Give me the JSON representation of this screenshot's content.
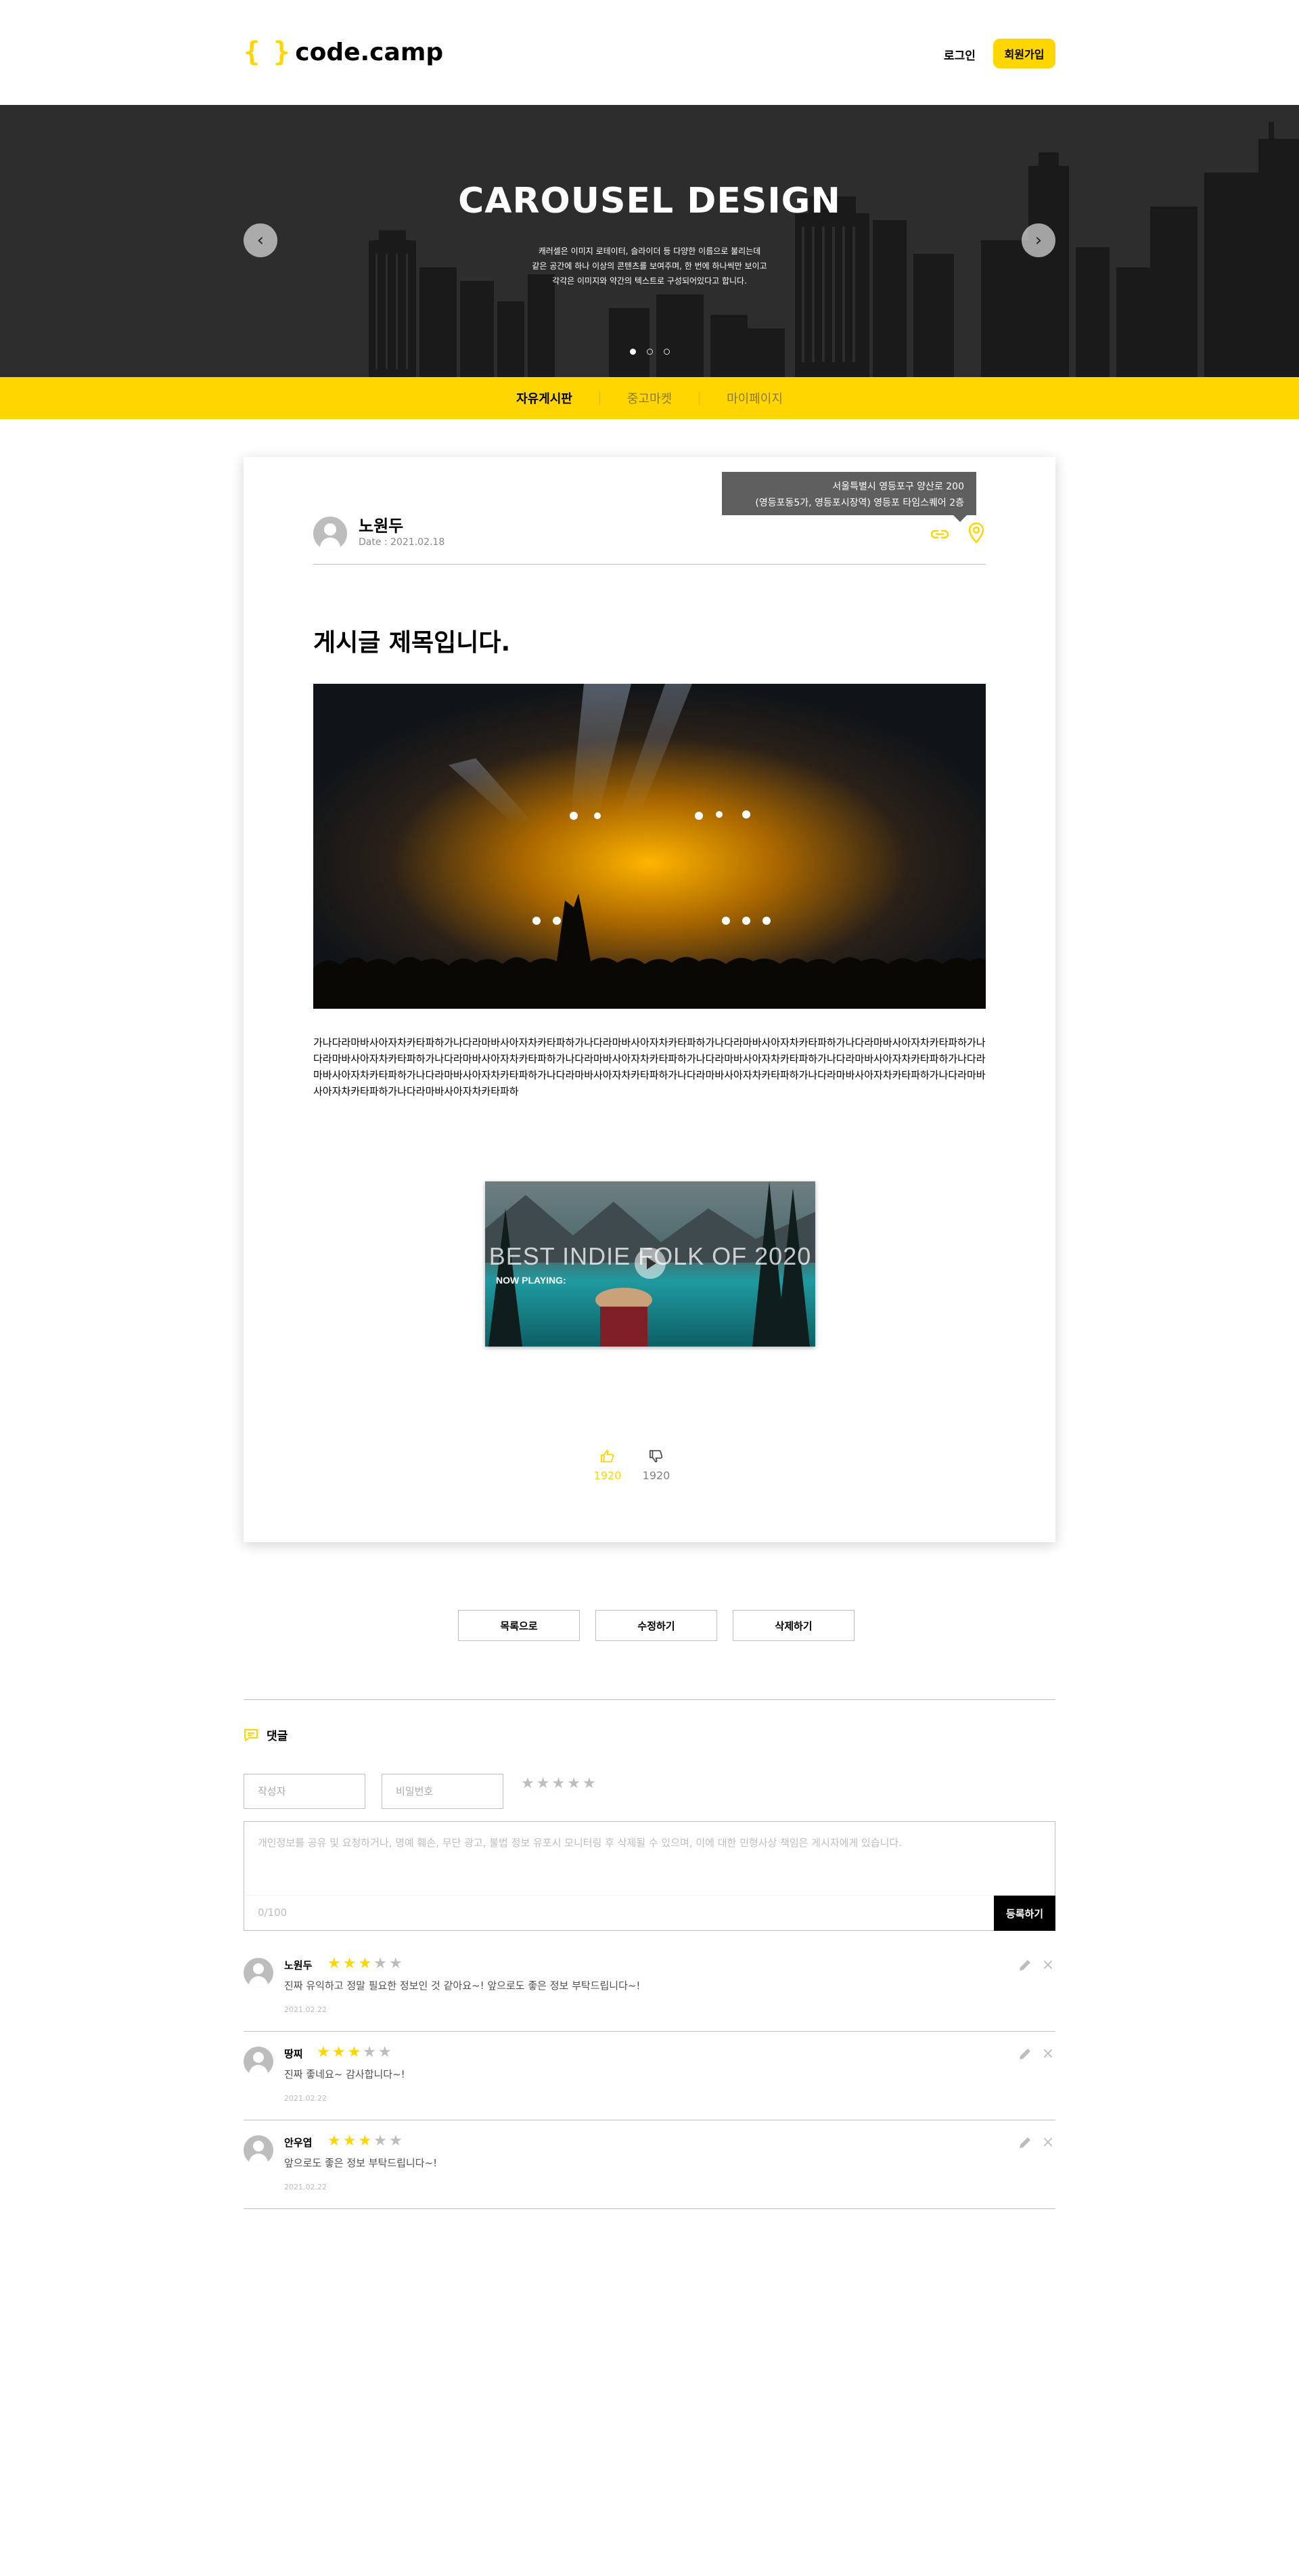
{
  "header": {
    "logo_braces": "{ }",
    "logo_text": "code.camp",
    "login": "로그인",
    "signup": "회원가입"
  },
  "banner": {
    "title": "CAROUSEL DESIGN",
    "desc_line1": "캐러셀은 이미지 로테이터, 슬라이더 등 다양한 이름으로 불리는데",
    "desc_line2": "같은 공간에 하나 이상의 콘텐츠를 보여주며, 한 번에 하나씩만 보이고",
    "desc_line3": "각각은 이미지와 약간의 텍스트로 구성되어있다고 합니다.",
    "prev": "‹",
    "next": "›",
    "dots_count": 3,
    "active_dot": 1
  },
  "nav": {
    "items": [
      "자유게시판",
      "중고마켓",
      "마이페이지"
    ],
    "active": "자유게시판"
  },
  "post": {
    "writer": "노원두",
    "date": "Date : 2021.02.18",
    "address_line1": "서울특별시 영등포구 양산로 200",
    "address_line2": "(영등포동5가, 영등포시장역) 영등포 타임스퀘어 2층",
    "title": "게시글 제목입니다.",
    "content": "가나다라마바사아자차카타파하가나다라마바사아자차카타파하가나다라마바사아자차카타파하가나다라마바사아자차카타파하가나다라마바사아자차카타파하가나다라마바사아자차카타파하가나다라마바사아자차카타파하가나다라마바사아자차카타파하가나다라마바사아자차카타파하가나다라마바사아자차카타파하가나다라마바사아자차카타파하가나다라마바사아자차카타파하가나다라마바사아자차카타파하가나다라마바사아자차카타파하가나다라마바사아자차카타파하가나다라마바사아자차카타파하가나다라마바사아자차카타파하",
    "video_title": "BEST INDIE FOLK OF 2020",
    "video_now": "NOW PLAYING:",
    "likes": "1920",
    "dislikes": "1920"
  },
  "actions": {
    "list": "목록으로",
    "edit": "수정하기",
    "delete": "삭제하기"
  },
  "comment_form": {
    "header": "댓글",
    "writer_placeholder": "작성자",
    "password_placeholder": "비밀번호",
    "rating": 0,
    "content_placeholder": "개인정보를 공유 및 요청하거나, 명예 훼손, 무단 광고, 불법 정보 유포시 모니터링 후 삭제될 수 있으며, 이에 대한 민형사상 책임은 게시자에게 있습니다.",
    "count": "0/100",
    "submit": "등록하기"
  },
  "comments": [
    {
      "writer": "노원두",
      "rating": 3,
      "text": "진짜 유익하고 정말 필요한 정보인 것 같아요~! 앞으로도 좋은 정보 부탁드립니다~!",
      "date": "2021.02.22"
    },
    {
      "writer": "땅찌",
      "rating": 3,
      "text": "진짜 좋네요~ 감사합니다~!",
      "date": "2021.02.22"
    },
    {
      "writer": "안우엽",
      "rating": 3,
      "text": "앞으로도 좋은 정보 부탁드립니다~!",
      "date": "2021.02.22"
    }
  ],
  "colors": {
    "accent": "#FFD600",
    "dark": "#000000",
    "gray": "#BDBDBD",
    "tooltip": "#5F5F5F"
  }
}
